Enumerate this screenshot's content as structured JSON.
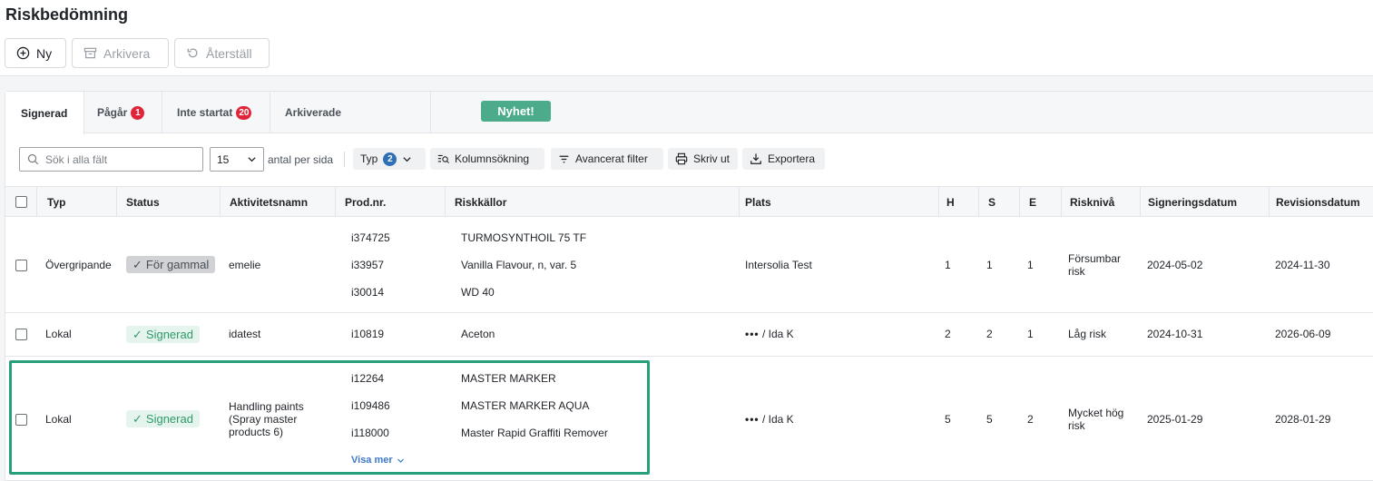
{
  "page": {
    "title": "Riskbedömning"
  },
  "actions": {
    "new": "Ny",
    "archive": "Arkivera",
    "restore": "Återställ"
  },
  "tabs": [
    {
      "label": "Signerad"
    },
    {
      "label": "Pågår",
      "badge": "1"
    },
    {
      "label": "Inte startat",
      "badge": "20"
    },
    {
      "label": "Arkiverade"
    }
  ],
  "news_badge": "Nyhet!",
  "toolbar": {
    "search_placeholder": "Sök i alla fält",
    "per_page_value": "15",
    "per_page_label": "antal per sida",
    "type_label": "Typ",
    "type_count": "2",
    "column_search": "Kolumnsökning",
    "advanced_filter": "Avancerat filter",
    "print": "Skriv ut",
    "export": "Exportera"
  },
  "columns": [
    "Typ",
    "Status",
    "Aktivitetsnamn",
    "Prod.nr.",
    "Riskkällor",
    "Plats",
    "H",
    "S",
    "E",
    "Risknivå",
    "Signeringsdatum",
    "Revisionsdatum"
  ],
  "rows": [
    {
      "typ": "Övergripande",
      "status": "För gammal",
      "activity": [
        "emelie"
      ],
      "prod": [
        "i374725",
        "i33957",
        "i30014"
      ],
      "sources": [
        "TURMOSYNTHOIL 75 TF",
        "Vanilla Flavour, n, var. 5",
        "WD 40"
      ],
      "place": "Intersolia Test",
      "h": "1",
      "s": "1",
      "e": "1",
      "risk": [
        "Försumbar",
        "risk"
      ],
      "signed": "2024-05-02",
      "revision": "2024-11-30"
    },
    {
      "typ": "Lokal",
      "status": "Signerad",
      "activity": [
        "idatest"
      ],
      "prod": [
        "i10819"
      ],
      "sources": [
        "Aceton"
      ],
      "place_dots": "•••",
      "place": "/ Ida K",
      "h": "2",
      "s": "2",
      "e": "1",
      "risk": [
        "Låg risk"
      ],
      "signed": "2024-10-31",
      "revision": "2026-06-09"
    },
    {
      "typ": "Lokal",
      "status": "Signerad",
      "activity": [
        "Handling paints",
        "(Spray master",
        "products 6)"
      ],
      "prod": [
        "i12264",
        "i109486",
        "i118000"
      ],
      "sources": [
        "MASTER MARKER",
        "MASTER MARKER AQUA",
        "Master Rapid Graffiti Remover"
      ],
      "show_more": "Visa mer",
      "place_dots": "•••",
      "place": "/ Ida K",
      "h": "5",
      "s": "5",
      "e": "2",
      "risk": [
        "Mycket hög",
        "risk"
      ],
      "signed": "2025-01-29",
      "revision": "2028-01-29"
    }
  ],
  "colors": {
    "accent_green": "#25a07a",
    "badge_red": "#e0243a",
    "news_green": "#4bab8b",
    "count_blue": "#2f6fb5"
  }
}
